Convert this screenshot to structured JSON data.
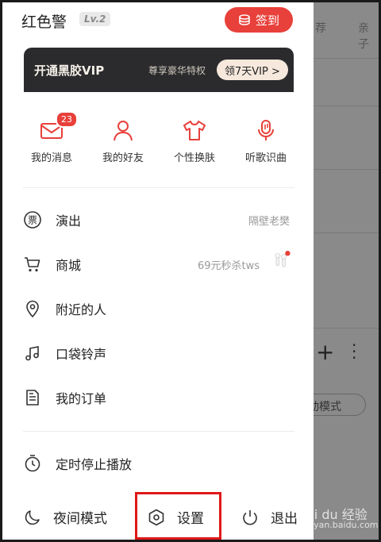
{
  "profile": {
    "username": "红色警",
    "level": "Lv.2",
    "signin_label": "签到"
  },
  "vip": {
    "title": "开通黑胶VIP",
    "subtitle": "尊享豪华特权",
    "button_label": "领7天VIP >"
  },
  "quick_actions": [
    {
      "label": "我的消息",
      "icon": "mail-icon",
      "badge": "23"
    },
    {
      "label": "我的好友",
      "icon": "person-icon"
    },
    {
      "label": "个性换肤",
      "icon": "tshirt-icon"
    },
    {
      "label": "听歌识曲",
      "icon": "mic-icon"
    }
  ],
  "menu": [
    {
      "label": "演出",
      "icon": "ticket-icon",
      "extra": "隔壁老樊"
    },
    {
      "label": "商城",
      "icon": "cart-icon",
      "extra": "69元秒杀tws"
    },
    {
      "label": "附近的人",
      "icon": "location-icon"
    },
    {
      "label": "口袋铃声",
      "icon": "ringtone-icon"
    },
    {
      "label": "我的订单",
      "icon": "order-icon"
    },
    {
      "label": "定时停止播放",
      "icon": "timer-icon"
    }
  ],
  "bottom": {
    "night_mode": "夜间模式",
    "settings": "设置",
    "logout": "退出"
  },
  "background_app": {
    "tab_1": "荐",
    "tab_2": "亲子",
    "mode_label": "动模式"
  },
  "watermark": {
    "brand": "Bai du 经验",
    "url": "jingyan.baidu.com"
  },
  "colors": {
    "accent": "#e8403a",
    "highlight_box": "#e01818",
    "vip_bg": "#2b2b2d"
  }
}
